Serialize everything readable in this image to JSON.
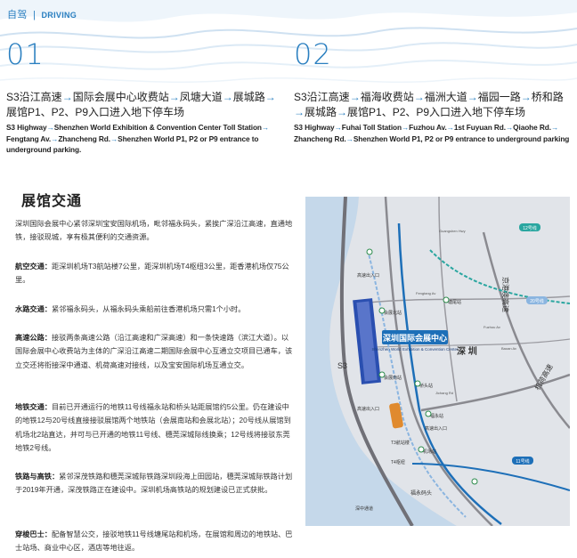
{
  "header": {
    "zh": "自驾",
    "en": "DRIVING"
  },
  "routes": [
    {
      "number": "01",
      "zh_lines": [
        [
          "S3沿江高速",
          "国际会展中心收费站",
          "凤塘大道",
          "展城路"
        ],
        [
          "展馆P1、P2、P9入口进入地下停车场"
        ]
      ],
      "en_lines": [
        "S3 Highway→Shenzhen World Exhibition & Convention Center Toll Station→",
        "Fengtang Av.→Zhancheng Rd.→Shenzhen World P1, P2 or P9 entrance to",
        "underground parking."
      ]
    },
    {
      "number": "02",
      "zh_lines": [
        [
          "S3沿江高速",
          "福海收费站",
          "福洲大道",
          "福园一路",
          "桥和路"
        ],
        [
          "展城路",
          "展馆P1、P2、P9入口进入地下停车场"
        ]
      ],
      "zh_line2_lead_arrow": true,
      "en_lines": [
        "S3 Highway→Fuhai Toll Station→Fuzhou Av.→1st Fuyuan Rd.→Qiaohe Rd.→",
        "Zhancheng Rd.→Shenzhen World P1, P2 or P9 entrance to underground parking"
      ]
    }
  ],
  "section_title": "展馆交通",
  "intro": "深圳国际会展中心紧邻深圳宝安国际机场，毗邻福永码头，紧挨广深沿江高速，直通地铁，接驳现城，享有极其便利的交通资源。",
  "paragraphs": [
    {
      "label": "航空交通：",
      "text": "距深圳机场T3航站楼7公里，距深圳机场T4枢纽3公里，距香港机场仅75公里。"
    },
    {
      "label": "水路交通：",
      "text": "紧邻福永码头，从福永码头乘船前往香港机场只需1个小时。"
    },
    {
      "label": "高速公路：",
      "text": "接驳两条高速公路（沿江高速和广深高速）和一条快速路（滨江大道）。以国际会展中心收费站为主体的广深沿江高速二期国际会展中心互通立交项目已通车，该立交还将衔接深中通道、机荷高速对接线，以及宝安国际机场互通立交。"
    },
    {
      "label": "地铁交通：",
      "text": "目前已开通运行的地铁11号线福永站和桥头站距展馆约5公里。仍在建设中的地铁12与20号线直接接驳展馆两个地铁站（会展南站和会展北站）；20号线从展馆到机场北2站直达，并可与已开通的地铁11号线、穗莞深城际线换乘；12号线将接驳东莞地铁2号线。"
    },
    {
      "label": "铁路与高铁：",
      "text": "紧邻深茂铁路和穗莞深城际铁路深圳段海上田园站，穗莞深城际铁路计划于2019年开通，深茂铁路正在建设中。深圳机场高铁站的规划建设已正式获批。"
    },
    {
      "label": "穿梭巴士：",
      "text": "配备智慧公交，接驳地铁11号线塘尾站和机场，在展馆和周边的地铁站、巴士站场、商业中心区，酒店等地往返。"
    }
  ],
  "map": {
    "venue_label_zh": "深圳国际会展中心",
    "venue_label_en": "Shenzhen World Exhibition & Convention Center",
    "city_zh": "深 圳",
    "road_s3": "S3",
    "road_jinggang": "京港澳高速",
    "road_jichang": "机荷高速",
    "gate_label": "高速出入口",
    "gate_labels_small": [
      "高速出入口",
      "高速出入口"
    ],
    "station_labels": [
      "会展北站",
      "会展南站",
      "福永站",
      "机场站",
      "桥头站",
      "塘尾站",
      "T3航站楼",
      "T4枢纽"
    ],
    "line_labels": [
      "11号线",
      "12号线",
      "20号线"
    ],
    "port_label": "福永码头",
    "tunnel_label": "深中通道",
    "road_labels_small": [
      "Fengtang Av",
      "Jichang Rd",
      "Fuzhou Av",
      "Baoan Av",
      "Guangshen Hwy"
    ],
    "colors": {
      "water": "#c5d8ea",
      "land": "#dfe2e7",
      "line11": "#1d6fb8",
      "line12": "#2aa6a0",
      "line20": "#8bb5e0",
      "road": "#6f6f75",
      "venue": "#2a4fb0",
      "accent": "#e08a2e"
    }
  }
}
